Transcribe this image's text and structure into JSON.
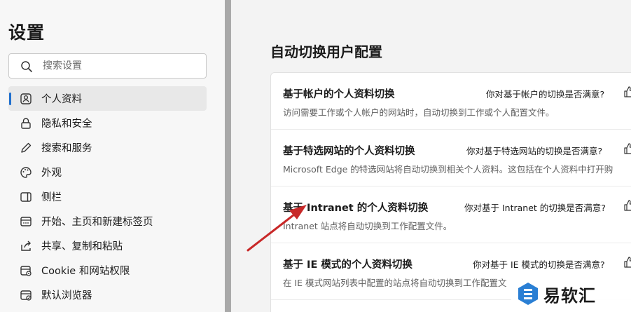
{
  "sidebar": {
    "title": "设置",
    "search": {
      "placeholder": "搜索设置",
      "icon": "search-icon"
    },
    "items": [
      {
        "label": "个人资料",
        "icon": "profile-icon",
        "active": true
      },
      {
        "label": "隐私和安全",
        "icon": "lock-icon",
        "active": false
      },
      {
        "label": "搜索和服务",
        "icon": "pencil-icon",
        "active": false
      },
      {
        "label": "外观",
        "icon": "palette-icon",
        "active": false
      },
      {
        "label": "侧栏",
        "icon": "sidebar-icon",
        "active": false
      },
      {
        "label": "开始、主页和新建标签页",
        "icon": "home-tab-icon",
        "active": false
      },
      {
        "label": "共享、复制和粘贴",
        "icon": "share-icon",
        "active": false
      },
      {
        "label": "Cookie 和网站权限",
        "icon": "cookie-icon",
        "active": false
      },
      {
        "label": "默认浏览器",
        "icon": "browser-icon",
        "active": false
      }
    ]
  },
  "main": {
    "title": "自动切换用户配置",
    "rows": [
      {
        "title": "基于帐户的个人资料切换",
        "feedback": "你对基于帐户的切换是否满意?",
        "description": "访问需要工作或个人帐户的网站时，自动切换到工作或个人配置文件。"
      },
      {
        "title": "基于特选网站的个人资料切换",
        "feedback": "你对基于特选网站的切换是否满意?",
        "description": "Microsoft Edge 的特选网站将自动切换到相关个人资料。这包括在个人资料中打开购"
      },
      {
        "title": "基于 Intranet 的个人资料切换",
        "feedback": "你对基于 Intranet 的切换是否满意?",
        "description": "Intranet 站点将自动切换到工作配置文件。"
      },
      {
        "title": "基于 IE 模式的个人资料切换",
        "feedback": "你对基于 IE 模式的切换是否满意?",
        "description": "在 IE 模式网站列表中配置的站点将自动切换到工作配置文"
      }
    ]
  },
  "watermark": {
    "text": "易软汇"
  },
  "colors": {
    "accent": "#1f6fce",
    "arrow": "#c82828",
    "divider": "#a9a9a9"
  }
}
